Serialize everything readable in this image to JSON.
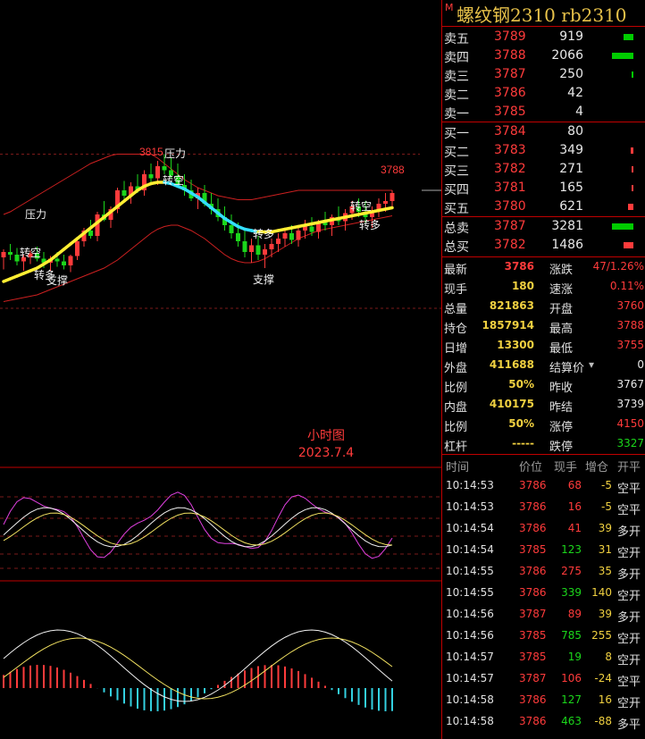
{
  "title": {
    "marker": "M",
    "text": "螺纹钢2310  rb2310"
  },
  "colors": {
    "up": "#ff3b3b",
    "down": "#1bd61b",
    "accent": "#f0d040",
    "ma": "#ffee33",
    "ma_down": "#33e0ff",
    "border": "#c00000"
  },
  "order_book": {
    "asks": [
      {
        "label": "卖五",
        "price": "3789",
        "volume": "919",
        "bar": 0.35,
        "bar_color": "green"
      },
      {
        "label": "卖四",
        "price": "3788",
        "volume": "2066",
        "bar": 0.8,
        "bar_color": "green"
      },
      {
        "label": "卖三",
        "price": "3787",
        "volume": "250",
        "bar": 0.06,
        "bar_color": "green"
      },
      {
        "label": "卖二",
        "price": "3786",
        "volume": "42",
        "bar": 0.0,
        "bar_color": "green"
      },
      {
        "label": "卖一",
        "price": "3785",
        "volume": "4",
        "bar": 0.0,
        "bar_color": "green"
      }
    ],
    "bids": [
      {
        "label": "买一",
        "price": "3784",
        "volume": "80",
        "bar": 0.0,
        "bar_color": "red"
      },
      {
        "label": "买二",
        "price": "3783",
        "volume": "349",
        "bar": 0.1,
        "bar_color": "red"
      },
      {
        "label": "买三",
        "price": "3782",
        "volume": "271",
        "bar": 0.08,
        "bar_color": "red"
      },
      {
        "label": "买四",
        "price": "3781",
        "volume": "165",
        "bar": 0.04,
        "bar_color": "red"
      },
      {
        "label": "买五",
        "price": "3780",
        "volume": "621",
        "bar": 0.2,
        "bar_color": "red"
      }
    ],
    "totals": [
      {
        "label": "总卖",
        "price": "3787",
        "volume": "3281",
        "bar": 0.8,
        "bar_color": "green"
      },
      {
        "label": "总买",
        "price": "3782",
        "volume": "1486",
        "bar": 0.35,
        "bar_color": "red"
      }
    ]
  },
  "stats": [
    {
      "l1": "最新",
      "v1": "3786",
      "c1": "r",
      "l2": "涨跌",
      "v2": "47/1.26%",
      "c2": "r"
    },
    {
      "l1": "现手",
      "v1": "180",
      "c1": "y",
      "l2": "速涨",
      "v2": "0.11%",
      "c2": "r"
    },
    {
      "l1": "总量",
      "v1": "821863",
      "c1": "y",
      "l2": "开盘",
      "v2": "3760",
      "c2": "r"
    },
    {
      "l1": "持仓",
      "v1": "1857914",
      "c1": "y",
      "l2": "最高",
      "v2": "3788",
      "c2": "r"
    },
    {
      "l1": "日增",
      "v1": "13300",
      "c1": "y",
      "l2": "最低",
      "v2": "3755",
      "c2": "r"
    },
    {
      "l1": "外盘",
      "v1": "411688",
      "c1": "y",
      "l2": "结算价",
      "v2": "0",
      "c2": "w",
      "dropdown": true
    },
    {
      "l1": "比例",
      "v1": "50%",
      "c1": "y",
      "l2": "昨收",
      "v2": "3767",
      "c2": "w"
    },
    {
      "l1": "内盘",
      "v1": "410175",
      "c1": "y",
      "l2": "昨结",
      "v2": "3739",
      "c2": "w"
    },
    {
      "l1": "比例",
      "v1": "50%",
      "c1": "y",
      "l2": "涨停",
      "v2": "4150",
      "c2": "r"
    },
    {
      "l1": "杠杆",
      "v1": "-----",
      "c1": "y",
      "l2": "跌停",
      "v2": "3327",
      "c2": "g"
    }
  ],
  "ticks": {
    "headers": {
      "time": "时间",
      "price": "价位",
      "vol": "现手",
      "oi": "增仓",
      "type": "开平"
    },
    "rows": [
      {
        "time": "10:14:53",
        "price": "3786",
        "vol": "68",
        "vc": "r",
        "oi": "-5",
        "oc": "y",
        "type": "空平"
      },
      {
        "time": "10:14:53",
        "price": "3786",
        "vol": "16",
        "vc": "r",
        "oi": "-5",
        "oc": "y",
        "type": "空平"
      },
      {
        "time": "10:14:54",
        "price": "3786",
        "vol": "41",
        "vc": "r",
        "oi": "39",
        "oc": "y",
        "type": "多开"
      },
      {
        "time": "10:14:54",
        "price": "3785",
        "vol": "123",
        "vc": "g",
        "oi": "31",
        "oc": "y",
        "type": "空开"
      },
      {
        "time": "10:14:55",
        "price": "3786",
        "vol": "275",
        "vc": "r",
        "oi": "35",
        "oc": "y",
        "type": "多开"
      },
      {
        "time": "10:14:55",
        "price": "3786",
        "vol": "339",
        "vc": "g",
        "oi": "140",
        "oc": "y",
        "type": "空开"
      },
      {
        "time": "10:14:56",
        "price": "3787",
        "vol": "89",
        "vc": "r",
        "oi": "39",
        "oc": "y",
        "type": "多开"
      },
      {
        "time": "10:14:56",
        "price": "3785",
        "vol": "785",
        "vc": "g",
        "oi": "255",
        "oc": "y",
        "type": "空开"
      },
      {
        "time": "10:14:57",
        "price": "3785",
        "vol": "19",
        "vc": "g",
        "oi": "8",
        "oc": "y",
        "type": "空开"
      },
      {
        "time": "10:14:57",
        "price": "3787",
        "vol": "106",
        "vc": "r",
        "oi": "-24",
        "oc": "y",
        "type": "空平"
      },
      {
        "time": "10:14:58",
        "price": "3786",
        "vol": "127",
        "vc": "g",
        "oi": "16",
        "oc": "y",
        "type": "空开"
      },
      {
        "time": "10:14:58",
        "price": "3786",
        "vol": "463",
        "vc": "g",
        "oi": "-88",
        "oc": "y",
        "type": "多平"
      }
    ]
  },
  "chart_data": {
    "type": "candlestick",
    "note_period": "小时图",
    "note_date": "2023.7.4",
    "annotations": {
      "high_label": "3815",
      "last_label": "3788",
      "pressure": "压力",
      "support": "支撑",
      "turn_short": "转空",
      "turn_long": "转多"
    },
    "ylim": [
      3700,
      3830
    ],
    "candles": [
      [
        3738,
        3744,
        3729,
        3742
      ],
      [
        3742,
        3748,
        3736,
        3740
      ],
      [
        3740,
        3745,
        3732,
        3735
      ],
      [
        3735,
        3740,
        3728,
        3738
      ],
      [
        3738,
        3743,
        3733,
        3741
      ],
      [
        3741,
        3746,
        3735,
        3737
      ],
      [
        3737,
        3742,
        3730,
        3734
      ],
      [
        3734,
        3739,
        3728,
        3737
      ],
      [
        3737,
        3742,
        3731,
        3735
      ],
      [
        3735,
        3740,
        3729,
        3732
      ],
      [
        3732,
        3740,
        3727,
        3739
      ],
      [
        3739,
        3752,
        3736,
        3750
      ],
      [
        3750,
        3760,
        3746,
        3758
      ],
      [
        3758,
        3766,
        3752,
        3754
      ],
      [
        3754,
        3772,
        3750,
        3770
      ],
      [
        3770,
        3780,
        3765,
        3766
      ],
      [
        3766,
        3776,
        3760,
        3774
      ],
      [
        3774,
        3790,
        3771,
        3788
      ],
      [
        3788,
        3795,
        3780,
        3784
      ],
      [
        3784,
        3794,
        3778,
        3791
      ],
      [
        3791,
        3800,
        3786,
        3788
      ],
      [
        3788,
        3803,
        3784,
        3800
      ],
      [
        3800,
        3808,
        3794,
        3797
      ],
      [
        3797,
        3810,
        3792,
        3806
      ],
      [
        3806,
        3815,
        3800,
        3803
      ],
      [
        3803,
        3812,
        3797,
        3799
      ],
      [
        3799,
        3808,
        3790,
        3792
      ],
      [
        3792,
        3800,
        3784,
        3788
      ],
      [
        3788,
        3796,
        3780,
        3782
      ],
      [
        3782,
        3790,
        3774,
        3786
      ],
      [
        3786,
        3792,
        3776,
        3778
      ],
      [
        3778,
        3786,
        3770,
        3774
      ],
      [
        3774,
        3782,
        3765,
        3768
      ],
      [
        3768,
        3776,
        3758,
        3762
      ],
      [
        3762,
        3770,
        3752,
        3756
      ],
      [
        3756,
        3764,
        3746,
        3750
      ],
      [
        3750,
        3760,
        3738,
        3742
      ],
      [
        3742,
        3752,
        3734,
        3747
      ],
      [
        3747,
        3754,
        3736,
        3740
      ],
      [
        3740,
        3748,
        3730,
        3744
      ],
      [
        3744,
        3752,
        3738,
        3748
      ],
      [
        3748,
        3756,
        3742,
        3752
      ],
      [
        3752,
        3760,
        3746,
        3756
      ],
      [
        3756,
        3762,
        3748,
        3751
      ],
      [
        3751,
        3760,
        3746,
        3758
      ],
      [
        3758,
        3766,
        3752,
        3761
      ],
      [
        3761,
        3768,
        3754,
        3757
      ],
      [
        3757,
        3766,
        3752,
        3764
      ],
      [
        3764,
        3772,
        3758,
        3762
      ],
      [
        3762,
        3770,
        3754,
        3768
      ],
      [
        3768,
        3776,
        3762,
        3765
      ],
      [
        3765,
        3774,
        3758,
        3771
      ],
      [
        3771,
        3780,
        3766,
        3776
      ],
      [
        3776,
        3782,
        3768,
        3772
      ],
      [
        3772,
        3780,
        3764,
        3768
      ],
      [
        3768,
        3776,
        3760,
        3773
      ],
      [
        3773,
        3782,
        3768,
        3778
      ],
      [
        3778,
        3786,
        3772,
        3780
      ],
      [
        3780,
        3788,
        3774,
        3786
      ]
    ],
    "ma": [
      3720,
      3722,
      3724,
      3726,
      3728,
      3730,
      3733,
      3736,
      3740,
      3744,
      3748,
      3752,
      3756,
      3760,
      3764,
      3768,
      3772,
      3776,
      3780,
      3784,
      3788,
      3791,
      3793,
      3794,
      3794,
      3793,
      3791,
      3789,
      3786,
      3783,
      3779,
      3775,
      3771,
      3767,
      3764,
      3761,
      3759,
      3758,
      3757,
      3757,
      3757,
      3758,
      3759,
      3760,
      3761,
      3762,
      3763,
      3764,
      3765,
      3766,
      3767,
      3768,
      3769,
      3770,
      3771,
      3772,
      3773,
      3774,
      3775
    ],
    "upper_band": [
      3770,
      3772,
      3775,
      3778,
      3781,
      3784,
      3787,
      3790,
      3793,
      3796,
      3799,
      3802,
      3805,
      3808,
      3810,
      3812,
      3814,
      3815,
      3815,
      3815,
      3815,
      3815,
      3815,
      3812,
      3808,
      3804,
      3800,
      3796,
      3793,
      3790,
      3788,
      3786,
      3784,
      3783,
      3782,
      3781,
      3781,
      3781,
      3782,
      3783,
      3784,
      3785,
      3786,
      3787,
      3788,
      3788,
      3788,
      3788,
      3788,
      3788,
      3788,
      3788,
      3788,
      3788,
      3788,
      3788,
      3788,
      3788,
      3788
    ],
    "lower_band": [
      3705,
      3706,
      3707,
      3708,
      3709,
      3710,
      3712,
      3714,
      3716,
      3718,
      3720,
      3722,
      3724,
      3726,
      3728,
      3730,
      3733,
      3736,
      3740,
      3744,
      3748,
      3752,
      3756,
      3759,
      3761,
      3762,
      3762,
      3760,
      3758,
      3755,
      3752,
      3748,
      3744,
      3740,
      3737,
      3735,
      3734,
      3734,
      3735,
      3737,
      3740,
      3743,
      3746,
      3749,
      3752,
      3754,
      3756,
      3758,
      3759,
      3760,
      3761,
      3762,
      3763,
      3764,
      3765,
      3766,
      3767,
      3768,
      3769
    ]
  }
}
